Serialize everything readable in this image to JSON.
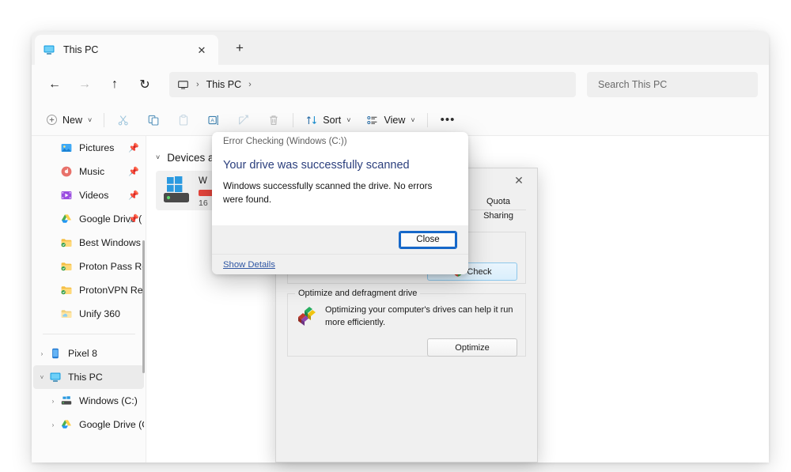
{
  "window": {
    "tab": {
      "title": "This PC",
      "icon": "this-pc-icon",
      "close_label": "✕",
      "new_tab_label": "+"
    }
  },
  "addressbar": {
    "back": "←",
    "forward": "→",
    "up": "↑",
    "refresh": "↻",
    "breadcrumb": {
      "root_icon": "monitor-icon",
      "sep1": "›",
      "label": "This PC",
      "sep2": "›"
    },
    "search": {
      "placeholder": "Search This PC",
      "value": ""
    }
  },
  "commandbar": {
    "new_label": "New",
    "chevron": "˅",
    "cut_label": "Cut",
    "copy_label": "Copy",
    "paste_label": "Paste",
    "rename_label": "Rename",
    "share_label": "Share",
    "delete_label": "Delete",
    "sort_label": "Sort",
    "view_label": "View",
    "more_label": "•••"
  },
  "sidebar": {
    "items": [
      {
        "label": "Pictures",
        "icon": "pictures-icon",
        "pinned": true,
        "twisty": "",
        "indent": 0
      },
      {
        "label": "Music",
        "icon": "music-icon",
        "pinned": true,
        "twisty": "",
        "indent": 0
      },
      {
        "label": "Videos",
        "icon": "videos-icon",
        "pinned": true,
        "twisty": "",
        "indent": 0
      },
      {
        "label": "Google Drive (",
        "icon": "google-drive-icon",
        "pinned": true,
        "twisty": "",
        "indent": 0
      },
      {
        "label": "Best Windows AV",
        "icon": "synced-folder-icon",
        "pinned": false,
        "twisty": "",
        "indent": 0
      },
      {
        "label": "Proton Pass Revie",
        "icon": "synced-folder-icon",
        "pinned": false,
        "twisty": "",
        "indent": 0
      },
      {
        "label": "ProtonVPN Revie",
        "icon": "synced-folder-icon",
        "pinned": false,
        "twisty": "",
        "indent": 0
      },
      {
        "label": "Unify 360",
        "icon": "cloud-folder-icon",
        "pinned": false,
        "twisty": "",
        "indent": 0
      }
    ],
    "tree": [
      {
        "label": "Pixel 8",
        "icon": "phone-icon",
        "twisty": "›",
        "selected": false,
        "indent": 0
      },
      {
        "label": "This PC",
        "icon": "this-pc-icon",
        "twisty": "˅",
        "selected": true,
        "indent": 0
      },
      {
        "label": "Windows (C:)",
        "icon": "windows-drive-icon",
        "twisty": "›",
        "selected": false,
        "indent": 1
      },
      {
        "label": "Google Drive (G",
        "icon": "google-drive-icon",
        "twisty": "›",
        "selected": false,
        "indent": 1
      }
    ]
  },
  "content": {
    "group_title": "Devices a",
    "group_chevron": "˅",
    "drive": {
      "name": "W",
      "free_text": "16",
      "used_percent": 82
    }
  },
  "properties_window": {
    "close_label": "✕",
    "tabs": [
      {
        "label": "Quota"
      },
      {
        "label": "Sharing"
      }
    ],
    "error_checking": {
      "legend": "",
      "check_button": "Check"
    },
    "optimize": {
      "legend": "Optimize and defragment drive",
      "description": "Optimizing your computer's drives can help it run more efficiently.",
      "button": "Optimize"
    }
  },
  "error_dialog": {
    "title": "Error Checking (Windows (C:))",
    "heading": "Your drive was successfully scanned",
    "body": "Windows successfully scanned the drive. No errors were found.",
    "close_button": "Close",
    "show_details": "Show Details",
    "accent_color": "#1668c9",
    "heading_color": "#2b3f7d"
  }
}
